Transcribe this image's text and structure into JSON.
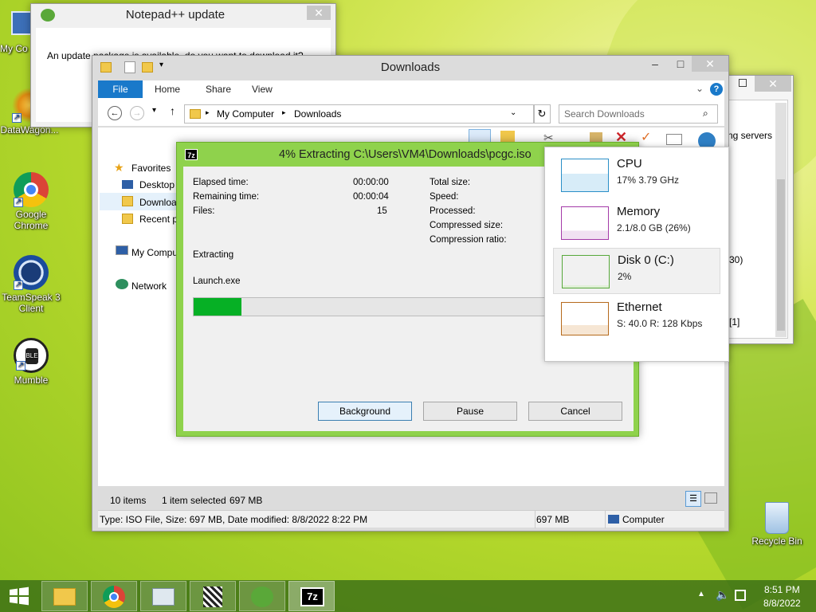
{
  "desktop": {
    "icons": [
      {
        "label": "My Co",
        "icon": "computer-icon"
      },
      {
        "label": "DataWagon...",
        "icon": "datawagon-icon"
      },
      {
        "label": "Google Chrome",
        "icon": "chrome-icon"
      },
      {
        "label": "TeamSpeak 3 Client",
        "icon": "teamspeak-icon"
      },
      {
        "label": "Mumble",
        "icon": "mumble-icon"
      },
      {
        "label": "Recycle Bin",
        "icon": "recycle-bin-icon"
      }
    ]
  },
  "notepad_update": {
    "title": "Notepad++ update",
    "message": "An update package is available, do you want to download it?"
  },
  "explorer": {
    "title": "Downloads",
    "ribbon_tabs": [
      "File",
      "Home",
      "Share",
      "View"
    ],
    "breadcrumb": [
      "My Computer",
      "Downloads"
    ],
    "search_placeholder": "Search Downloads",
    "nav": {
      "favorites": "Favorites",
      "desktop": "Desktop",
      "downloads": "Downloa",
      "recent": "Recent pl",
      "my_computer": "My Compu",
      "network": "Network"
    },
    "status": {
      "items": "10 items",
      "selected": "1 item selected",
      "selected_size": "697 MB"
    },
    "details": {
      "info": "Type: ISO File, Size: 697 MB, Date modified: 8/8/2022 8:22 PM",
      "size": "697 MB",
      "location": "Computer"
    }
  },
  "back_window": {
    "fragments": [
      "ng servers",
      "30)",
      "[1]"
    ]
  },
  "extract_dialog": {
    "title": "4% Extracting C:\\Users\\VM4\\Downloads\\pcgc.iso",
    "app_icon_label": "7z",
    "left_rows": [
      {
        "label": "Elapsed time:",
        "value": "00:00:00"
      },
      {
        "label": "Remaining time:",
        "value": "00:00:04"
      },
      {
        "label": "Files:",
        "value": "15"
      }
    ],
    "right_rows": [
      "Total size:",
      "Speed:",
      "Processed:",
      "Compressed size:",
      "Compression ratio:"
    ],
    "operation": "Extracting",
    "current_file": "Launch.exe",
    "progress_percent": 4,
    "buttons": {
      "background": "Background",
      "pause": "Pause",
      "cancel": "Cancel"
    }
  },
  "perf_panel": [
    {
      "name": "CPU",
      "value": "17%  3.79 GHz",
      "color": "#2a8fc7"
    },
    {
      "name": "Memory",
      "value": "2.1/8.0 GB (26%)",
      "color": "#a43aa8"
    },
    {
      "name": "Disk 0 (C:)",
      "value": "2%",
      "color": "#57a83a"
    },
    {
      "name": "Ethernet",
      "value": "S: 40.0  R: 128 Kbps",
      "color": "#b66a1c"
    }
  ],
  "taskbar": {
    "time": "8:51 PM",
    "date": "8/8/2022",
    "seven_zip_label": "7z"
  }
}
